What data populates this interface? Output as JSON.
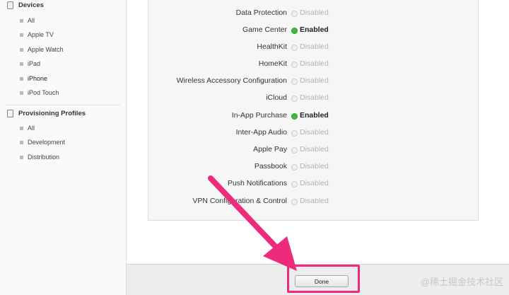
{
  "sidebar": {
    "devices": {
      "header": "Devices",
      "items": [
        "All",
        "Apple TV",
        "Apple Watch",
        "iPad",
        "iPhone",
        "iPod Touch"
      ]
    },
    "profiles": {
      "header": "Provisioning Profiles",
      "items": [
        "All",
        "Development",
        "Distribution"
      ]
    }
  },
  "services": [
    {
      "name": "Data Protection",
      "status": "Disabled",
      "enabled": false
    },
    {
      "name": "Game Center",
      "status": "Enabled",
      "enabled": true
    },
    {
      "name": "HealthKit",
      "status": "Disabled",
      "enabled": false
    },
    {
      "name": "HomeKit",
      "status": "Disabled",
      "enabled": false
    },
    {
      "name": "Wireless Accessory Configuration",
      "status": "Disabled",
      "enabled": false
    },
    {
      "name": "iCloud",
      "status": "Disabled",
      "enabled": false
    },
    {
      "name": "In-App Purchase",
      "status": "Enabled",
      "enabled": true
    },
    {
      "name": "Inter-App Audio",
      "status": "Disabled",
      "enabled": false
    },
    {
      "name": "Apple Pay",
      "status": "Disabled",
      "enabled": false
    },
    {
      "name": "Passbook",
      "status": "Disabled",
      "enabled": false
    },
    {
      "name": "Push Notifications",
      "status": "Disabled",
      "enabled": false
    },
    {
      "name": "VPN Configuration & Control",
      "status": "Disabled",
      "enabled": false
    }
  ],
  "footer": {
    "done_label": "Done"
  },
  "watermark": "@稀土掘金技术社区",
  "colors": {
    "enabled": "#3cb83c",
    "annotation": "#ee2a7b",
    "disabled_text": "#b3b3b3"
  }
}
